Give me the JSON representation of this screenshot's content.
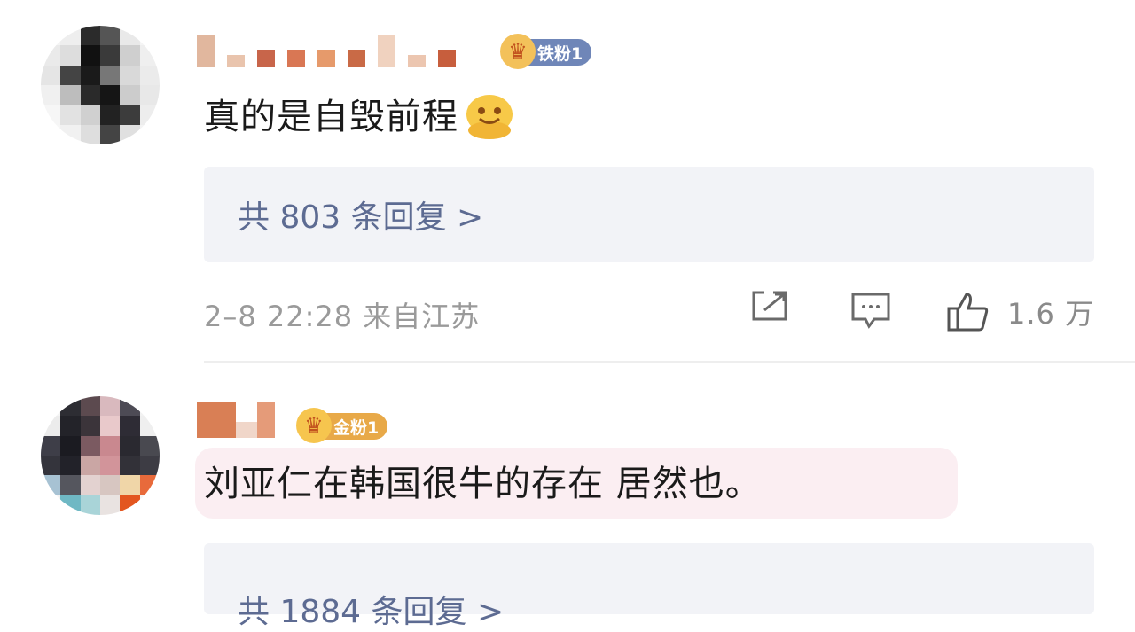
{
  "comments": [
    {
      "badge": "铁粉1",
      "text": "真的是自毁前程",
      "replies": "共 803 条回复 >",
      "meta": "2–8 22:28 来自江苏",
      "likes": "1.6 万"
    },
    {
      "badge": "金粉1",
      "text": "刘亚仁在韩国很牛的存在 居然也。",
      "replies": "共 1884 条回复 >"
    }
  ],
  "icons": {
    "share": "share-icon",
    "comment": "comment-icon",
    "like": "thumbs-up-icon",
    "emoji": "smile-emoji-icon",
    "badge": "fan-crown-icon"
  },
  "colors": {
    "reply_text": "#5d6b92",
    "reply_bg": "#f2f3f7",
    "iron_badge": "#6f86b8",
    "gold_badge": "#e8a948",
    "highlight": "#fbeef2"
  }
}
